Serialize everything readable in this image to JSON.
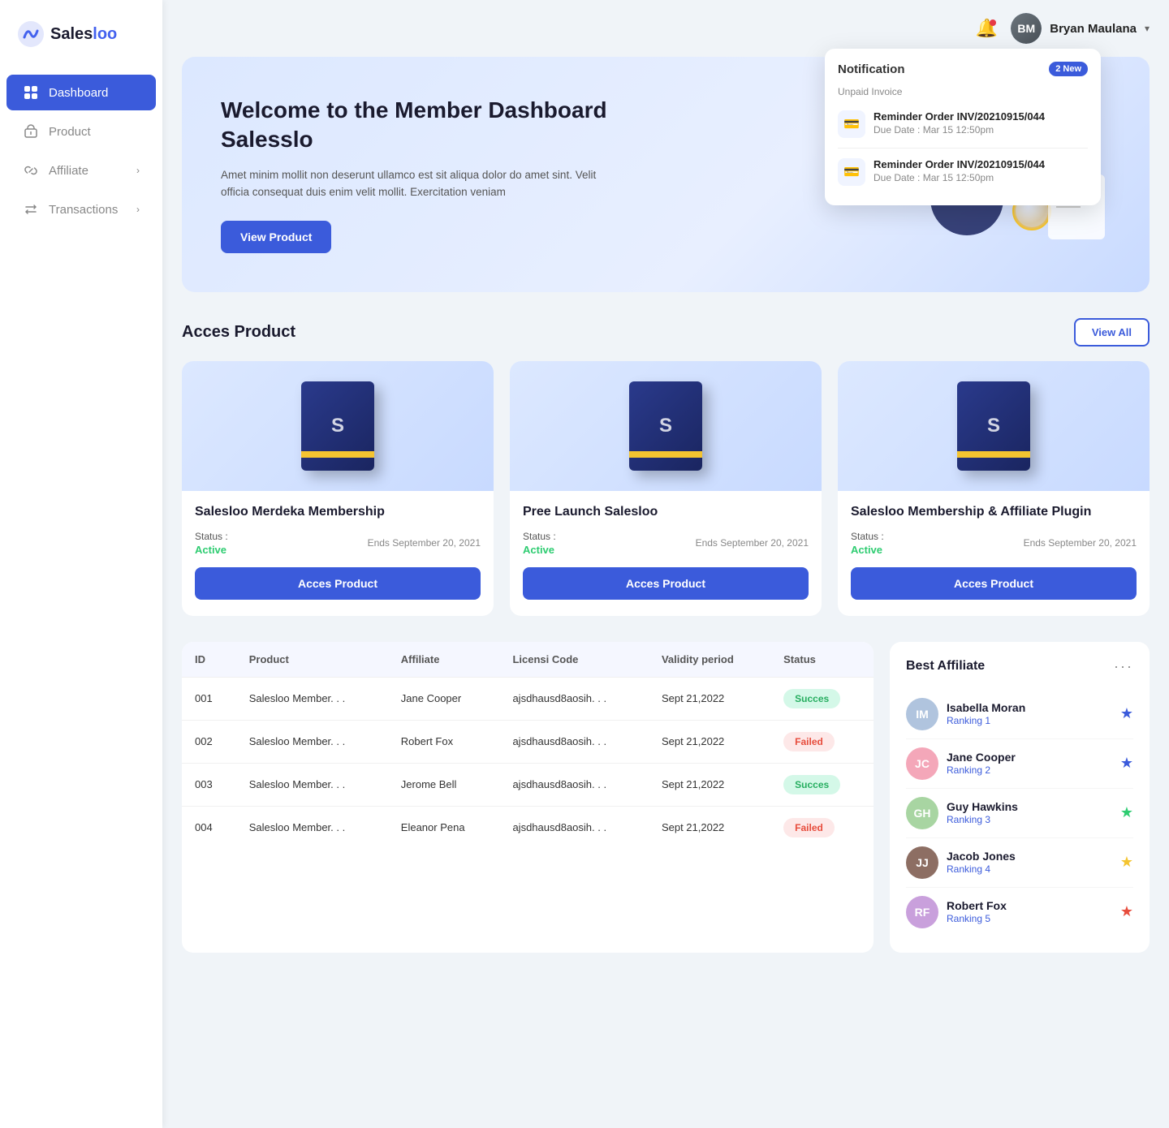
{
  "app": {
    "name": "Salesloo",
    "logo_text": "Sales",
    "logo_accent": "loo"
  },
  "sidebar": {
    "items": [
      {
        "id": "dashboard",
        "label": "Dashboard",
        "icon": "grid-icon",
        "active": true,
        "hasArrow": false
      },
      {
        "id": "product",
        "label": "Product",
        "icon": "box-icon",
        "active": false,
        "hasArrow": false
      },
      {
        "id": "affiliate",
        "label": "Affiliate",
        "icon": "link-icon",
        "active": false,
        "hasArrow": true
      },
      {
        "id": "transactions",
        "label": "Transactions",
        "icon": "swap-icon",
        "active": false,
        "hasArrow": true
      }
    ]
  },
  "header": {
    "user_name": "Bryan Maulana",
    "user_initials": "BM"
  },
  "notification": {
    "title": "Notification",
    "badge": "2 New",
    "section_label": "Unpaid Invoice",
    "items": [
      {
        "title": "Reminder Order INV/20210915/044",
        "due": "Due Date : Mar 15 12:50pm"
      },
      {
        "title": "Reminder Order INV/20210915/044",
        "due": "Due Date : Mar 15 12:50pm"
      }
    ]
  },
  "hero": {
    "title": "Welcome to the Member Dashboard Salesslo",
    "description": "Amet minim mollit non deserunt ullamco est sit aliqua dolor do amet sint. Velit officia consequat duis enim velit mollit. Exercitation veniam",
    "button_label": "View Product"
  },
  "products_section": {
    "title": "Acces Product",
    "view_all_label": "View All",
    "items": [
      {
        "name": "Salesloo Merdeka Membership",
        "status_label": "Status :",
        "status_value": "Active",
        "ends_label": "Ends September 20, 2021",
        "button_label": "Acces Product"
      },
      {
        "name": "Pree Launch Salesloo",
        "status_label": "Status :",
        "status_value": "Active",
        "ends_label": "Ends September 20, 2021",
        "button_label": "Acces Product"
      },
      {
        "name": "Salesloo Membership & Affiliate Plugin",
        "status_label": "Status :",
        "status_value": "Active",
        "ends_label": "Ends September 20, 2021",
        "button_label": "Acces Product"
      }
    ]
  },
  "table": {
    "columns": [
      "ID",
      "Product",
      "Affiliate",
      "Licensi Code",
      "Validity period",
      "Status"
    ],
    "rows": [
      {
        "id": "001",
        "product": "Salesloo Member. . .",
        "affiliate": "Jane Cooper",
        "license": "ajsdhausd8aosih. . .",
        "validity": "Sept 21,2022",
        "status": "Succes",
        "status_type": "success"
      },
      {
        "id": "002",
        "product": "Salesloo Member. . .",
        "affiliate": "Robert Fox",
        "license": "ajsdhausd8aosih. . .",
        "validity": "Sept 21,2022",
        "status": "Failed",
        "status_type": "failed"
      },
      {
        "id": "003",
        "product": "Salesloo Member. . .",
        "affiliate": "Jerome Bell",
        "license": "ajsdhausd8aosih. . .",
        "validity": "Sept 21,2022",
        "status": "Succes",
        "status_type": "success"
      },
      {
        "id": "004",
        "product": "Salesloo Member. . .",
        "affiliate": "Eleanor Pena",
        "license": "ajsdhausd8aosih. . .",
        "validity": "Sept 21,2022",
        "status": "Failed",
        "status_type": "failed"
      }
    ]
  },
  "best_affiliate": {
    "title": "Best Affiliate",
    "items": [
      {
        "name": "Isabella Moran",
        "rank": "Ranking 1",
        "star_color": "blue",
        "initials": "IM",
        "bg": "#b0c4de"
      },
      {
        "name": "Jane Cooper",
        "rank": "Ranking 2",
        "star_color": "blue",
        "initials": "JC",
        "bg": "#f4a7b9"
      },
      {
        "name": "Guy Hawkins",
        "rank": "Ranking 3",
        "star_color": "green",
        "initials": "GH",
        "bg": "#a8d5a2"
      },
      {
        "name": "Jacob Jones",
        "rank": "Ranking 4",
        "star_color": "gold",
        "initials": "JJ",
        "bg": "#8d6e63"
      },
      {
        "name": "Robert Fox",
        "rank": "Ranking 5",
        "star_color": "red",
        "initials": "RF",
        "bg": "#c9a0dc"
      }
    ]
  }
}
